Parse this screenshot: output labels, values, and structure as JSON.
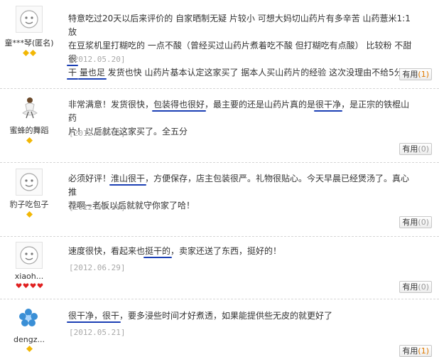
{
  "reviews": [
    {
      "username": "童***琴(匿名)",
      "avatar": "default-face-icon",
      "level": "gold",
      "badge_count": 2,
      "content": [
        "特意吃过20天以后来评价的 自家晒制无疑 片较小 可想大妈切山药片有多辛苦 山药薏米1:1放",
        "在豆浆机里打糊吃的 一点不酸（曾经买过山药片煮着吃不酸 但打糊吃有点酸） 比较粉 不甜 ",
        "很",
        "干",
        " ",
        "量也足",
        " 发货也快 山药片基本认定这家买了 据本人买山药片的经验 这次没理由不给5分"
      ],
      "date": "[2012.05.20]",
      "useful_label": "有用",
      "useful_count": "(1)"
    },
    {
      "username": "蜜蜂的舞蹈",
      "avatar": "dancer-avatar-icon",
      "level": "gold",
      "badge_count": 1,
      "content": [
        "非常满意！发货很快，",
        "包装得也很好",
        "，最主要的还是山药片真的是",
        "很干净",
        "，是正宗的铁棍山药",
        "片！以后就在这家买了。全五分"
      ],
      "date": "[2012.06.05]",
      "useful_label": "有用",
      "useful_count": "(0)"
    },
    {
      "username": "豹子吃包子",
      "avatar": "default-face-icon",
      "level": "gold",
      "badge_count": 1,
      "content": [
        "必须好评！",
        "淮山很干",
        "，方便保存，店主包装很严。礼物很贴心。今天早晨已经煲汤了。真心推",
        "荐啊~老板以后就就守你家了哈！"
      ],
      "date": "[2012.05.30]",
      "useful_label": "有用",
      "useful_count": "(0)"
    },
    {
      "username": "xiaoh...",
      "avatar": "default-face-icon",
      "level": "red",
      "badge_count": 4,
      "content": [
        "速度很快，看起来也",
        "挺干的",
        "，卖家还送了东西，挺好的！"
      ],
      "date": "[2012.06.29]",
      "useful_label": "有用",
      "useful_count": "(0)"
    },
    {
      "username": "dengz...",
      "avatar": "blue-flower-avatar-icon",
      "level": "gold",
      "badge_count": 1,
      "content": [
        "很干净，很干",
        "，要多浸些时间才好煮透，如果能提供些无皮的就更好了"
      ],
      "date": "[2012.05.21]",
      "useful_label": "有用",
      "useful_count": "(1)"
    }
  ],
  "colors": {
    "underline": "#1b3fb4",
    "date": "#a9a9a9",
    "useful_count_highlight": "#e07a00",
    "gold_badge": "#f2b705",
    "red_badge": "#e02020",
    "divider": "#d6d6d6"
  }
}
